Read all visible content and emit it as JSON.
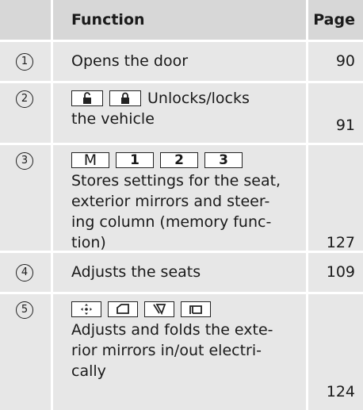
{
  "header": {
    "function_label": "Function",
    "page_label": "Page"
  },
  "rows": [
    {
      "number": "1",
      "lines": [
        "Opens the door"
      ],
      "page": "90"
    },
    {
      "number": "2",
      "inline_text": "Unlocks/locks",
      "lines": [
        "the vehicle"
      ],
      "page": "91"
    },
    {
      "number": "3",
      "memory_keys": [
        "M",
        "1",
        "2",
        "3"
      ],
      "lines": [
        "Stores settings for the seat,",
        "exterior mirrors and steer-",
        "ing column (memory func-",
        "tion)"
      ],
      "page": "127"
    },
    {
      "number": "4",
      "lines": [
        "Adjusts the seats"
      ],
      "page": "109"
    },
    {
      "number": "5",
      "lines": [
        "Adjusts and folds the exte-",
        "rior mirrors in/out electri-",
        "cally"
      ],
      "page": "124"
    }
  ],
  "icons": {
    "row2": [
      "unlock-icon",
      "lock-icon"
    ],
    "row5": [
      "mirror-adjust-icon",
      "left-mirror-icon",
      "right-mirror-icon",
      "mirror-fold-icon"
    ]
  }
}
